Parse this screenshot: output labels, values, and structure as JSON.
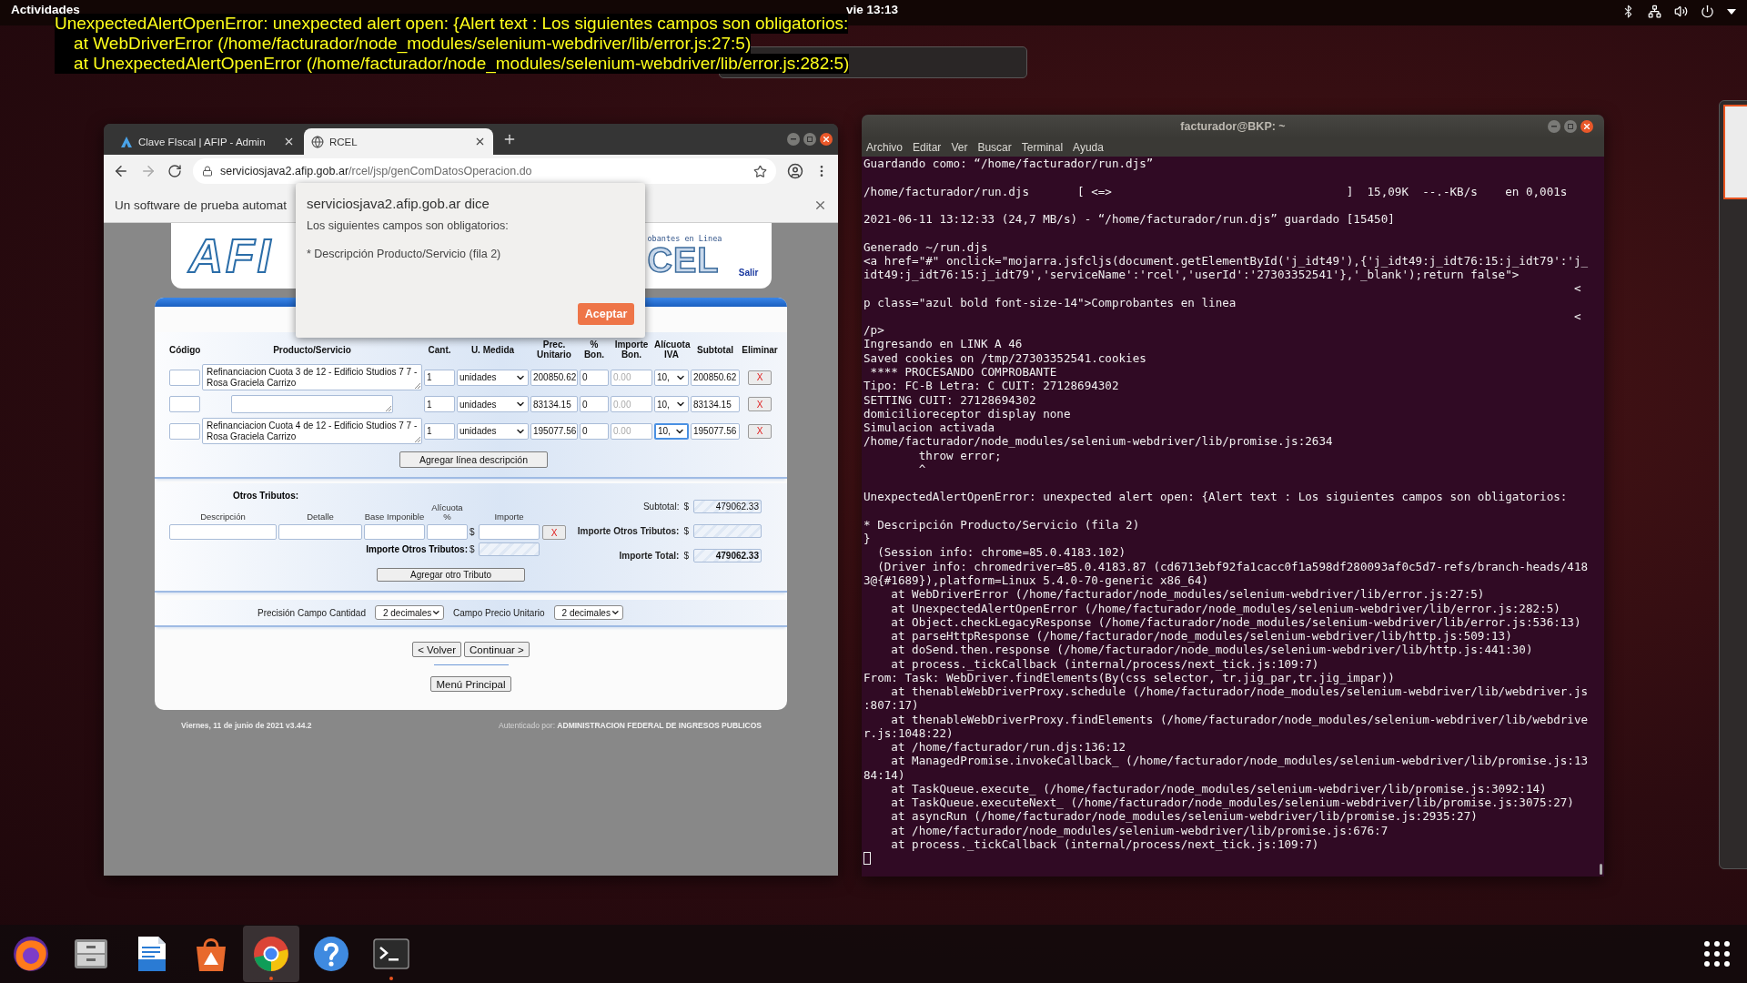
{
  "top_bar": {
    "activities": "Actividades",
    "clock": "vie 13:13"
  },
  "error_overlay": {
    "lines": [
      "UnexpectedAlertOpenError: unexpected alert open: {Alert text : Los siguientes campos son obligatorios:",
      "    at WebDriverError (/home/facturador/node_modules/selenium-webdriver/lib/error.js:27:5)",
      "    at UnexpectedAlertOpenError (/home/facturador/node_modules/selenium-webdriver/lib/error.js:282:5)"
    ]
  },
  "browser": {
    "tabs": [
      {
        "title": "Clave FIscal | AFIP - Admin",
        "selected": false
      },
      {
        "title": "RCEL",
        "selected": true
      }
    ],
    "url": {
      "host": "serviciosjava2.afip.gob.ar",
      "path": "/rcel/jsp/genComDatosOperacion.do"
    },
    "infobar": "Un software de prueba automat",
    "page": {
      "header": {
        "logo": "AFI",
        "subtitle": "obantes en Linea",
        "product_logo": "CEL",
        "logout": "Salir"
      },
      "items": {
        "columns": [
          "Código",
          "Producto/Servicio",
          "Cant.",
          "U. Medida",
          "Prec. Unitario",
          "% Bon.",
          "Importe Bon.",
          "Alícuota IVA",
          "Subtotal",
          "Eliminar"
        ],
        "rows": [
          {
            "producto": "Refinanciacion Cuota 3 de 12 - Edificio Studios 7 7 - Rosa Graciela Carrizo",
            "cantidad": "1",
            "unidad": "unidades",
            "precio": "200850.62",
            "bonificacion": "0",
            "importe_bonificacion": {
              "placeholder": "0.00"
            },
            "alicuota": "10,",
            "alicuota_focused": false,
            "subtotal": "200850.62",
            "delete": "X"
          },
          {
            "cantidad": "1",
            "unidad": "unidades",
            "precio": "83134.15",
            "bonificacion": "0",
            "importe_bonificacion": {
              "placeholder": "0.00"
            },
            "alicuota": "10,",
            "alicuota_focused": false,
            "subtotal": "83134.15",
            "delete": "X"
          },
          {
            "producto": "Refinanciacion Cuota 4 de 12 - Edificio Studios 7 7 - Rosa Graciela Carrizo",
            "cantidad": "1",
            "unidad": "unidades",
            "precio": "195077.56",
            "bonificacion": "0",
            "importe_bonificacion": {
              "placeholder": "0.00"
            },
            "alicuota": "10,",
            "alicuota_focused": true,
            "subtotal": "195077.56",
            "delete": "X"
          }
        ],
        "add_button": "Agregar línea descripción"
      },
      "tributos": {
        "title": "Otros Tributos:",
        "columns": [
          "Descripción",
          "Detalle",
          "Base Imponible",
          "Alícuota %",
          "Importe"
        ],
        "currency": "$",
        "delete": "X",
        "total_label": "Importe Otros Tributos:",
        "total_currency": "$",
        "add_button": "Agregar otro Tributo"
      },
      "totals": [
        {
          "label": "Subtotal:",
          "currency": "$",
          "value": "479062.33",
          "bold": false
        },
        {
          "label": "Importe Otros Tributos:",
          "currency": "$",
          "bold": true
        },
        {
          "label": "Importe Total:",
          "currency": "$",
          "value": "479062.33",
          "bold": true
        }
      ],
      "precision": [
        {
          "label": "Precisión Campo Cantidad",
          "value": "2 decimales"
        },
        {
          "label": "Campo Precio Unitario",
          "value": "2 decimales"
        }
      ],
      "nav_buttons": [
        "< Volver",
        "Continuar >"
      ],
      "menu_button": "Menú Principal",
      "footer": {
        "date": "Viernes, 11 de junio de 2021 v3.44.2",
        "auth": "Autenticado por: **ADMINISTRACION FEDERAL DE INGRESOS PUBLICOS**"
      }
    },
    "dialog": {
      "title": "serviciosjava2.afip.gob.ar dice",
      "message": "Los siguientes campos son obligatorios:",
      "detail": "* Descripción Producto/Servicio (fila 2)",
      "button": "Aceptar"
    }
  },
  "terminal": {
    "title": "facturador@BKP: ~",
    "menu": [
      "Archivo",
      "Editar",
      "Ver",
      "Buscar",
      "Terminal",
      "Ayuda"
    ],
    "lines": [
      {
        "text": "Guardando como: “/home/facturador/run.djs”"
      },
      {
        "text": "/home/facturador/run.djs       [ <=>                                  ]  15,09K  --.-KB/s    en 0,001s",
        "space_before": true
      },
      {
        "text": "2021-06-11 13:12:33 (24,7 MB/s) - “/home/facturador/run.djs” guardado [15450]",
        "space_before": true
      },
      {
        "text": "Generado ~/run.djs",
        "space_before": true
      },
      {
        "text": "<a href=\"#\" onclick=\"mojarra.jsfcljs(document.getElementById('j_idt49'),{'j_idt49:j_idt76:15:j_idt79':'j_"
      },
      {
        "text": "idt49:j_idt76:15:j_idt79','serviceName':'rcel','userId':'27303352541'},'_blank');return false\">"
      },
      {
        "text": "                                                                                                       <"
      },
      {
        "text": "p class=\"azul bold font-size-14\">Comprobantes en linea"
      },
      {
        "text": "                                                                                                       <"
      },
      {
        "text": "/p>"
      },
      {
        "text": "Ingresando en LINK A 46"
      },
      {
        "text": "Saved cookies on /tmp/27303352541.cookies"
      },
      {
        "text": " **** PROCESANDO COMPROBANTE"
      },
      {
        "text": "Tipo: FC-B Letra: C CUIT: 27128694302"
      },
      {
        "text": "SETTING CUIT: 27128694302"
      },
      {
        "text": "domicilioreceptor display none"
      },
      {
        "text": "Simulacion activada"
      },
      {
        "text": "/home/facturador/node_modules/selenium-webdriver/lib/promise.js:2634"
      },
      {
        "text": "        throw error;"
      },
      {
        "text": "        ^"
      },
      {
        "text": "UnexpectedAlertOpenError: unexpected alert open: {Alert text : Los siguientes campos son obligatorios:",
        "space_before": true
      },
      {
        "text": "* Descripción Producto/Servicio (fila 2)",
        "space_before": true
      },
      {
        "text": "}"
      },
      {
        "text": "  (Session info: chrome=85.0.4183.102)"
      },
      {
        "text": "  (Driver info: chromedriver=85.0.4183.87 (cd6713ebf92fa1cacc0f1a598df280093af0c5d7-refs/branch-heads/418"
      },
      {
        "text": "3@{#1689}),platform=Linux 5.4.0-70-generic x86_64)"
      },
      {
        "text": "    at WebDriverError (/home/facturador/node_modules/selenium-webdriver/lib/error.js:27:5)"
      },
      {
        "text": "    at UnexpectedAlertOpenError (/home/facturador/node_modules/selenium-webdriver/lib/error.js:282:5)"
      },
      {
        "text": "    at Object.checkLegacyResponse (/home/facturador/node_modules/selenium-webdriver/lib/error.js:536:13)"
      },
      {
        "text": "    at parseHttpResponse (/home/facturador/node_modules/selenium-webdriver/lib/http.js:509:13)"
      },
      {
        "text": "    at doSend.then.response (/home/facturador/node_modules/selenium-webdriver/lib/http.js:441:30)"
      },
      {
        "text": "    at process._tickCallback (internal/process/next_tick.js:109:7)"
      },
      {
        "text": "From: Task: WebDriver.findElements(By(css selector, tr.jig_par,tr.jig_impar))"
      },
      {
        "text": "    at thenableWebDriverProxy.schedule (/home/facturador/node_modules/selenium-webdriver/lib/webdriver.js"
      },
      {
        "text": ":807:17)"
      },
      {
        "text": "    at thenableWebDriverProxy.findElements (/home/facturador/node_modules/selenium-webdriver/lib/webdrive"
      },
      {
        "text": "r.js:1048:22)"
      },
      {
        "text": "    at /home/facturador/run.djs:136:12"
      },
      {
        "text": "    at ManagedPromise.invokeCallback_ (/home/facturador/node_modules/selenium-webdriver/lib/promise.js:13"
      },
      {
        "text": "84:14)"
      },
      {
        "text": "    at TaskQueue.execute_ (/home/facturador/node_modules/selenium-webdriver/lib/promise.js:3092:14)"
      },
      {
        "text": "    at TaskQueue.executeNext_ (/home/facturador/node_modules/selenium-webdriver/lib/promise.js:3075:27)"
      },
      {
        "text": "    at asyncRun (/home/facturador/node_modules/selenium-webdriver/lib/promise.js:2935:27)"
      },
      {
        "text": "    at /home/facturador/node_modules/selenium-webdriver/lib/promise.js:676:7"
      },
      {
        "text": "    at process._tickCallback (internal/process/next_tick.js:109:7)"
      }
    ]
  },
  "dock": [
    {
      "kind": "firefox",
      "selected": false,
      "running": false
    },
    {
      "kind": "files",
      "selected": false,
      "running": false
    },
    {
      "kind": "writer",
      "selected": false,
      "running": false
    },
    {
      "kind": "software",
      "selected": false,
      "running": false
    },
    {
      "kind": "chrome",
      "selected": true,
      "running": true
    },
    {
      "kind": "help",
      "selected": false,
      "running": false
    },
    {
      "kind": "terminal",
      "selected": false,
      "running": true
    }
  ]
}
